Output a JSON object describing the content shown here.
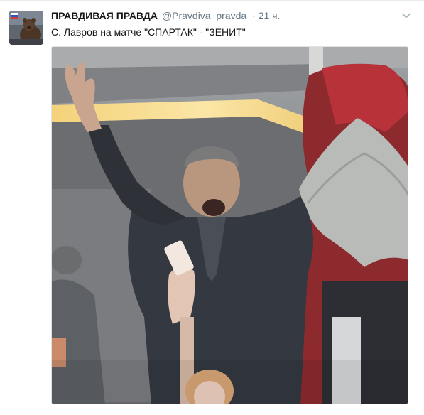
{
  "tweet": {
    "author_name": "ПРАВДИВАЯ ПРАВДА",
    "author_handle": "@Pravdiva_pravda",
    "separator": "·",
    "timestamp": "21 ч.",
    "text": "С. Лавров на матче \"СПАРТАК\" - \"ЗЕНИТ\""
  },
  "icons": {
    "avatar": "bear-avatar",
    "menu": "chevron-down-icon"
  },
  "colors": {
    "name": "#14171a",
    "secondary": "#657786",
    "background": "#ffffff",
    "media_border": "#dfe3e6"
  }
}
